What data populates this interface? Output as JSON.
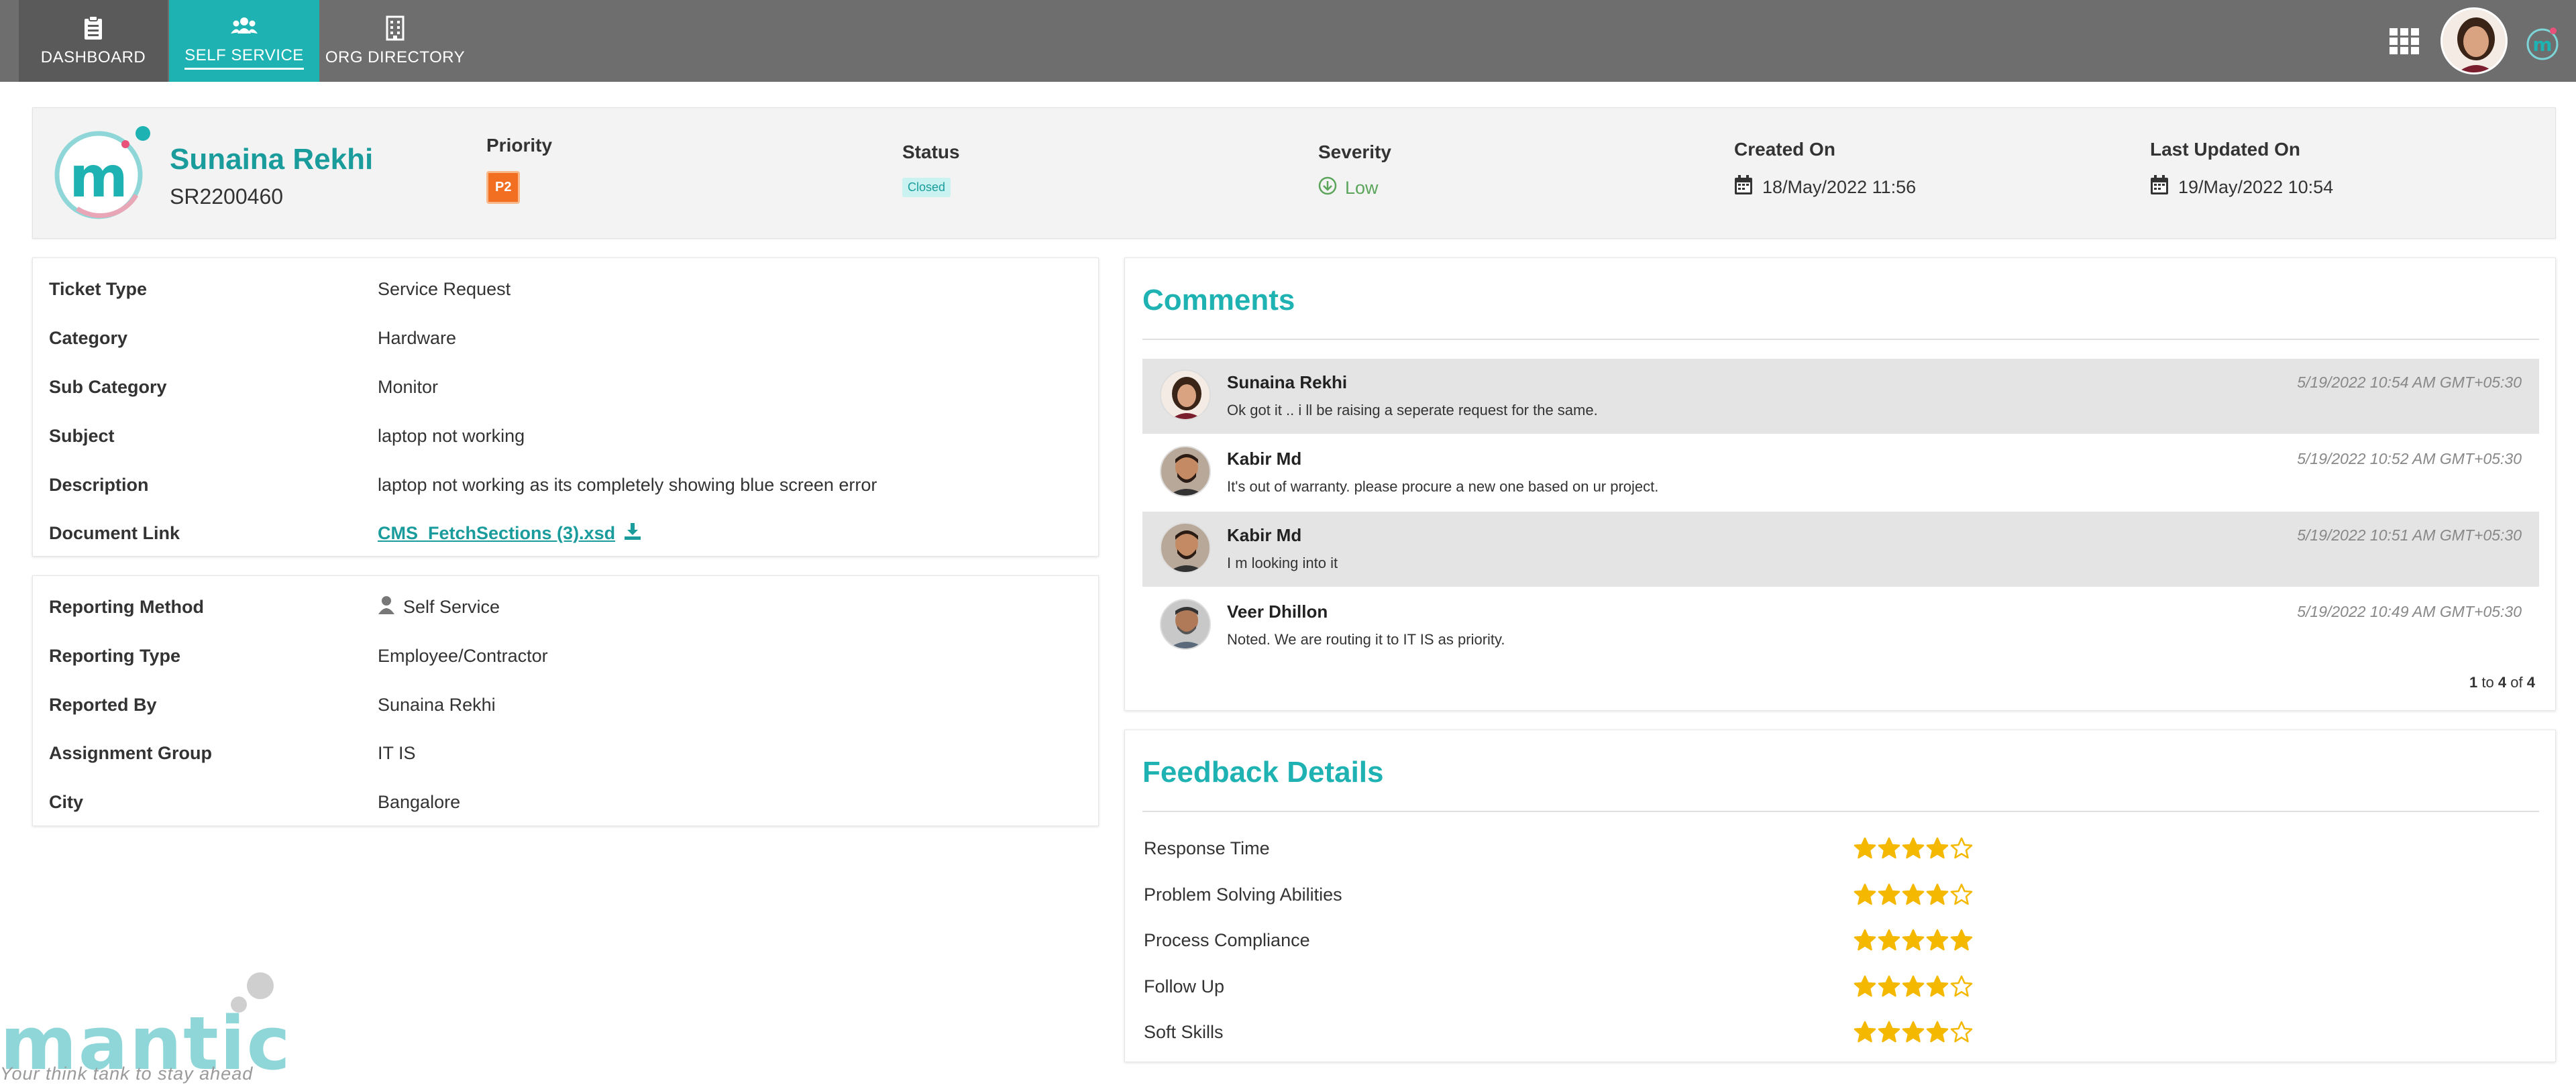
{
  "nav": {
    "tabs": [
      {
        "label": "DASHBOARD",
        "icon": "clipboard-icon"
      },
      {
        "label": "SELF SERVICE",
        "icon": "users-icon"
      },
      {
        "label": "ORG DIRECTORY",
        "icon": "building-icon"
      }
    ],
    "apps_icon": "apps-grid-icon",
    "accent": "#1fb2b2"
  },
  "ticket": {
    "name": "Sunaina Rekhi",
    "id": "SR2200460",
    "priority_label": "Priority",
    "priority": "P2",
    "status_label": "Status",
    "status": "Closed",
    "severity_label": "Severity",
    "severity": "Low",
    "created_label": "Created On",
    "created": "18/May/2022 11:56",
    "updated_label": "Last Updated On",
    "updated": "19/May/2022 10:54"
  },
  "details": [
    {
      "key": "Ticket Type",
      "value": "Service Request"
    },
    {
      "key": "Category",
      "value": "Hardware"
    },
    {
      "key": "Sub Category",
      "value": "Monitor"
    },
    {
      "key": "Subject",
      "value": "laptop not working"
    },
    {
      "key": "Description",
      "value": "laptop not working as its completely showing blue screen error"
    },
    {
      "key": "Document Link",
      "value": "CMS_FetchSections (3).xsd"
    }
  ],
  "reporting": [
    {
      "key": "Reporting Method",
      "value": "Self Service"
    },
    {
      "key": "Reporting Type",
      "value": "Employee/Contractor"
    },
    {
      "key": "Reported By",
      "value": "Sunaina Rekhi"
    },
    {
      "key": "Assignment Group",
      "value": "IT IS"
    },
    {
      "key": "City",
      "value": "Bangalore"
    }
  ],
  "comments": {
    "title": "Comments",
    "items": [
      {
        "author": "Sunaina Rekhi",
        "text": "Ok got it .. i ll be raising a seperate request for the same.",
        "time": "5/19/2022 10:54 AM GMT+05:30"
      },
      {
        "author": "Kabir Md",
        "text": "It's out of warranty. please procure a new one based on ur project.",
        "time": "5/19/2022 10:52 AM GMT+05:30"
      },
      {
        "author": "Kabir Md",
        "text": "I m looking into it",
        "time": "5/19/2022 10:51 AM GMT+05:30"
      },
      {
        "author": "Veer Dhillon",
        "text": "Noted. We are routing it to IT IS as priority.",
        "time": "5/19/2022 10:49 AM GMT+05:30"
      }
    ],
    "pager": {
      "from": "1",
      "to_word": "to",
      "to": "4",
      "of_word": "of",
      "total": "4"
    }
  },
  "feedback": {
    "title": "Feedback Details",
    "items": [
      {
        "label": "Response Time",
        "rating": 4
      },
      {
        "label": "Problem Solving Abilities",
        "rating": 4
      },
      {
        "label": "Process Compliance",
        "rating": 5
      },
      {
        "label": "Follow Up",
        "rating": 4
      },
      {
        "label": "Soft Skills",
        "rating": 4
      }
    ],
    "star_color": "#f5b800"
  },
  "brand": {
    "word": "mantic",
    "tagline": "Your think tank to stay ahead"
  }
}
